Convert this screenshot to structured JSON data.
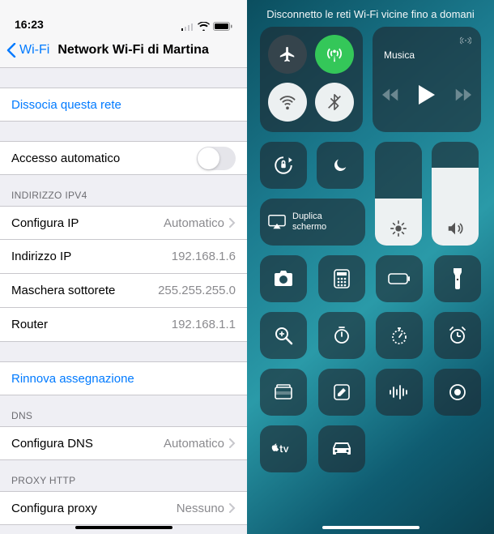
{
  "left": {
    "statusbar": {
      "time": "16:23"
    },
    "nav": {
      "back": "Wi-Fi",
      "title": "Network Wi-Fi di Martina"
    },
    "forget": "Dissocia questa rete",
    "auto_join": {
      "label": "Accesso automatico",
      "on": false
    },
    "ipv4_header": "INDIRIZZO IPV4",
    "ipv4": {
      "configure_label": "Configura IP",
      "configure_value": "Automatico",
      "ip_label": "Indirizzo IP",
      "ip_value": "192.168.1.6",
      "mask_label": "Maschera sottorete",
      "mask_value": "255.255.255.0",
      "router_label": "Router",
      "router_value": "192.168.1.1"
    },
    "renew": "Rinnova assegnazione",
    "dns_header": "DNS",
    "dns": {
      "label": "Configura DNS",
      "value": "Automatico"
    },
    "proxy_header": "PROXY HTTP",
    "proxy": {
      "label": "Configura proxy",
      "value": "Nessuno"
    }
  },
  "right": {
    "header": "Disconnetto le reti Wi-Fi vicine fino a domani",
    "music": {
      "title": "Musica"
    },
    "mirror": {
      "line1": "Duplica",
      "line2": "schermo"
    }
  }
}
